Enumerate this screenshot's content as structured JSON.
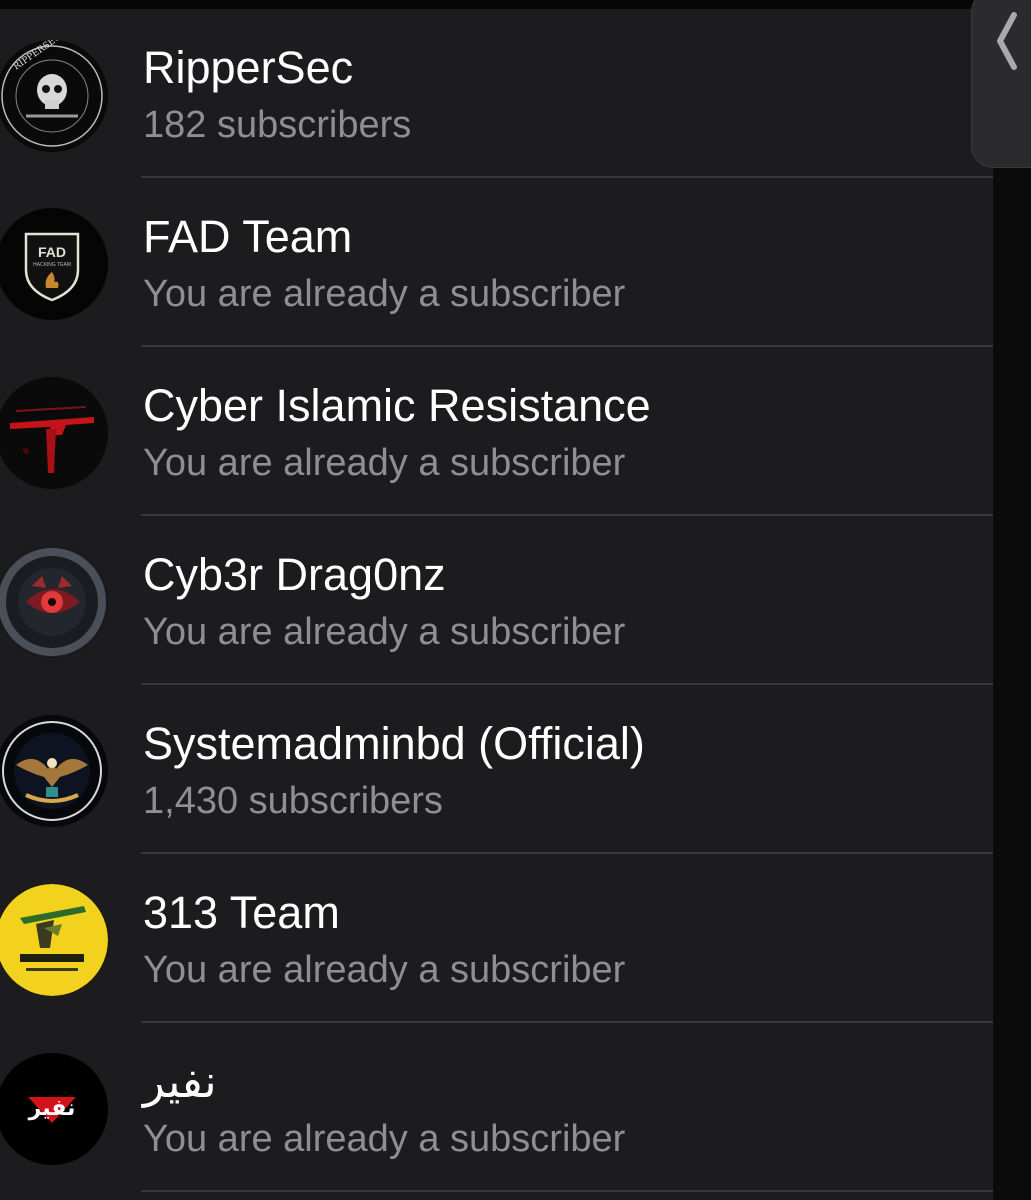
{
  "channels": [
    {
      "name": "RipperSec",
      "status": "182 subscribers",
      "avatar": "ripper-skull-logo"
    },
    {
      "name": "FAD Team",
      "status": "You are already a subscriber",
      "avatar": "fad-shield-logo"
    },
    {
      "name": "Cyber Islamic Resistance",
      "status": "You are already a subscriber",
      "avatar": "red-rifle-logo"
    },
    {
      "name": "Cyb3r Drag0nz",
      "status": "You are already a subscriber",
      "avatar": "dragon-eye-logo"
    },
    {
      "name": "Systemadminbd (Official)",
      "status": "1,430 subscribers",
      "avatar": "eagle-emblem-logo"
    },
    {
      "name": "313 Team",
      "status": "You are already a subscriber",
      "avatar": "yellow-313-logo"
    },
    {
      "name": "نفير",
      "status": "You are already a subscriber",
      "avatar": "nafir-logo"
    }
  ],
  "logo_text": {
    "ripper": "RIPPERSEC",
    "fad": "FAD",
    "fad_sub": "HACKING TEAM",
    "nafir": "نفير"
  },
  "colors": {
    "background": "#1c1c1e",
    "title": "#ffffff",
    "subtitle": "#8e8e93",
    "divider": "#38383b"
  }
}
